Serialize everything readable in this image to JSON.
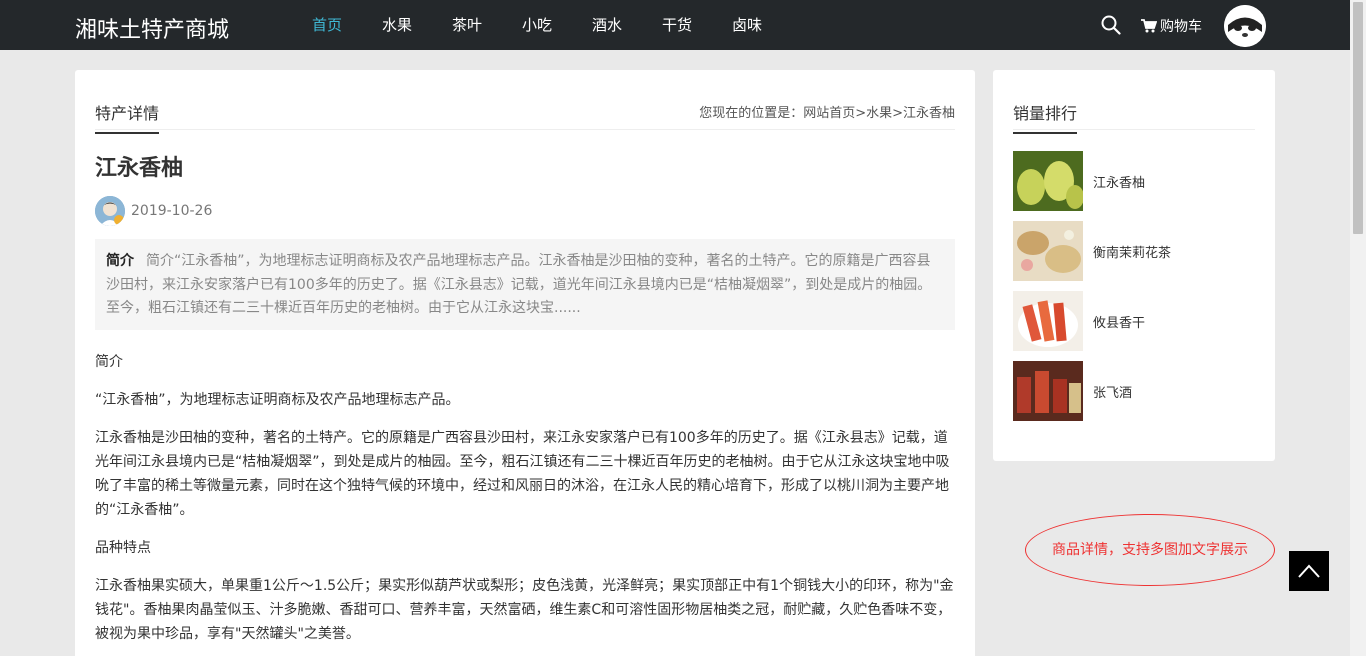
{
  "header": {
    "logo": "湘味土特产商城",
    "nav": [
      "首页",
      "水果",
      "茶叶",
      "小吃",
      "酒水",
      "干货",
      "卤味"
    ],
    "cart_label": "购物车"
  },
  "main": {
    "tab_label": "特产详情",
    "breadcrumb": "您现在的位置是：网站首页>水果>江永香柚",
    "title": "江永香柚",
    "date": "2019-10-26",
    "summary_label": "简介",
    "summary_text": "简介“江永香柚”，为地理标志证明商标及农产品地理标志产品。江永香柚是沙田柚的变种，著名的土特产。它的原籍是广西容县沙田村，来江永安家落户已有100多年的历史了。据《江永县志》记载，道光年间江永县境内已是“桔柚凝烟翠”，到处是成片的柚园。至今，粗石江镇还有二三十棵近百年历史的老柚树。由于它从江永这块宝......",
    "paragraphs": [
      "简介",
      "“江永香柚”，为地理标志证明商标及农产品地理标志产品。",
      "江永香柚是沙田柚的变种，著名的土特产。它的原籍是广西容县沙田村，来江永安家落户已有100多年的历史了。据《江永县志》记载，道光年间江永县境内已是“桔柚凝烟翠”，到处是成片的柚园。至今，粗石江镇还有二三十棵近百年历史的老柚树。由于它从江永这块宝地中吸吮了丰富的稀土等微量元素，同时在这个独特气候的环境中，经过和风丽日的沐浴，在江永人民的精心培育下，形成了以桃川洞为主要产地的“江永香柚”。",
      "品种特点",
      "江永香柚果实硕大，单果重1公斤～1.5公斤；果实形似葫芦状或梨形；皮色浅黄，光泽鲜亮；果实顶部正中有1个铜钱大小的印环，称为\"金钱花\"。香柚果肉晶莹似玉、汁多脆嫩、香甜可口、营养丰富，天然富硒，维生素C和可溶性固形物居柚类之冠，耐贮藏，久贮色香味不变，被视为果中珍品，享有\"天然罐头\"之美誉。"
    ]
  },
  "side": {
    "tab_label": "销量排行",
    "items": [
      {
        "name": "江永香柚",
        "thumb_color": "#8ea83a"
      },
      {
        "name": "衡南茉莉花茶",
        "thumb_color": "#d9b98a"
      },
      {
        "name": "攸县香干",
        "thumb_color": "#e0573a"
      },
      {
        "name": "张飞酒",
        "thumb_color": "#9a3b2b"
      }
    ]
  },
  "callout": "商品详情，支持多图加文字展示"
}
